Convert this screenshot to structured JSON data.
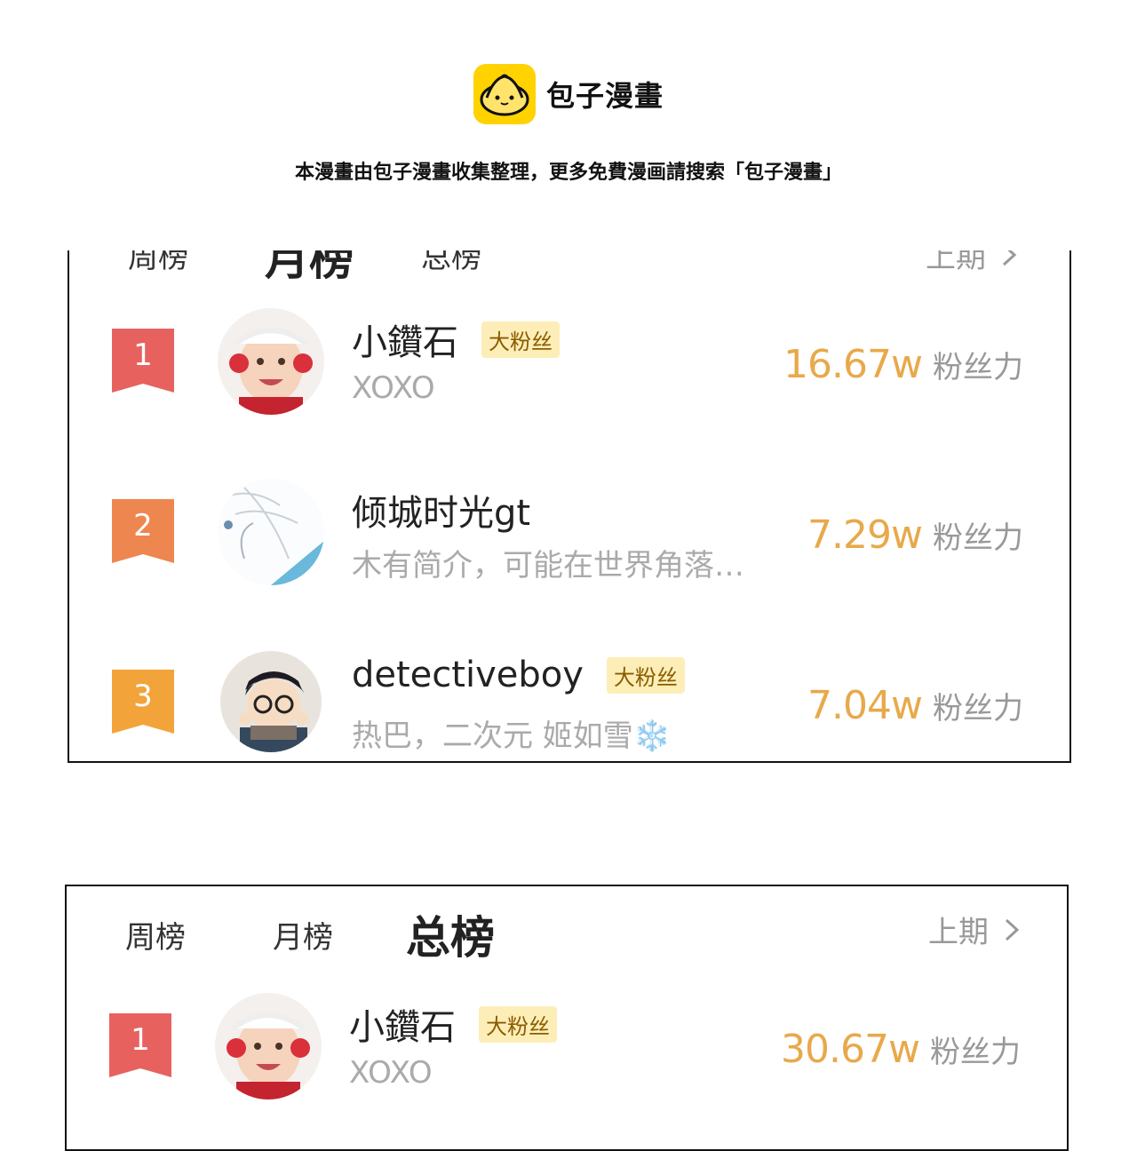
{
  "header": {
    "app_name": "包子漫畫",
    "notice": "本漫畫由包子漫畫收集整理，更多免費漫画請搜索「包子漫畫」"
  },
  "colors": {
    "logo_bg": "#ffd200",
    "rank1": "#e7625f",
    "rank2": "#ee8650",
    "rank3": "#f2a43b",
    "score": "#e8a94a",
    "badge_bg": "#fdeeb8"
  },
  "panel1": {
    "tabs": [
      "周榜",
      "月榜",
      "总榜"
    ],
    "active_tab": "月榜",
    "prev_label": "上期",
    "rows": [
      {
        "rank": "1",
        "name": "小鑽石",
        "badge": "大粉丝",
        "bio": "XOXO",
        "score": "16.67w",
        "unit": "粉丝力",
        "avatar": "baby-avatar"
      },
      {
        "rank": "2",
        "name": "倾城时光gt",
        "badge": "",
        "bio": "木有简介，可能在世界角落…",
        "score": "7.29w",
        "unit": "粉丝力",
        "avatar": "sketch-avatar"
      },
      {
        "rank": "3",
        "name": "detectiveboy",
        "badge": "大粉丝",
        "bio": "热巴，二次元 姬如雪❄️",
        "score": "7.04w",
        "unit": "粉丝力",
        "avatar": "detective-avatar"
      }
    ]
  },
  "panel2": {
    "tabs": [
      "周榜",
      "月榜",
      "总榜"
    ],
    "active_tab": "总榜",
    "prev_label": "上期",
    "rows": [
      {
        "rank": "1",
        "name": "小鑽石",
        "badge": "大粉丝",
        "bio": "XOXO",
        "score": "30.67w",
        "unit": "粉丝力",
        "avatar": "baby-avatar"
      }
    ]
  }
}
